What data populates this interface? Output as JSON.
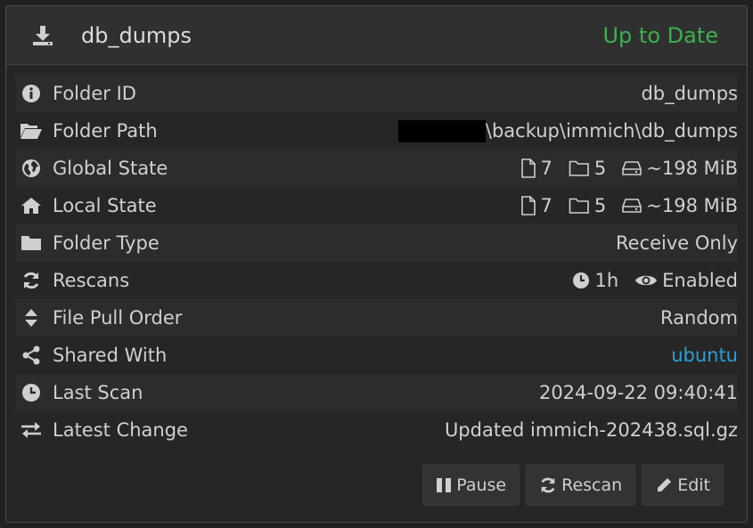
{
  "header": {
    "title": "db_dumps",
    "status": "Up to Date",
    "status_color": "#3bb14c",
    "icon": "download-icon"
  },
  "rows": [
    {
      "label": "Folder ID",
      "icon": "info-circle-icon",
      "value": "db_dumps"
    },
    {
      "label": "Folder Path",
      "icon": "folder-open-icon",
      "value": "\\backup\\immich\\db_dumps",
      "redacted": true
    },
    {
      "label": "Global State",
      "icon": "globe-icon",
      "files": "7",
      "folders": "5",
      "size": "~198 MiB"
    },
    {
      "label": "Local State",
      "icon": "home-icon",
      "files": "7",
      "folders": "5",
      "size": "~198 MiB"
    },
    {
      "label": "Folder Type",
      "icon": "folder-icon",
      "value": "Receive Only"
    },
    {
      "label": "Rescans",
      "icon": "refresh-icon",
      "interval": "1h",
      "watch": "Enabled"
    },
    {
      "label": "File Pull Order",
      "icon": "sort-icon",
      "value": "Random"
    },
    {
      "label": "Shared With",
      "icon": "share-icon",
      "value": "ubuntu",
      "link_color": "#2a9fd6"
    },
    {
      "label": "Last Scan",
      "icon": "clock-icon",
      "value": "2024-09-22 09:40:41"
    },
    {
      "label": "Latest Change",
      "icon": "exchange-icon",
      "value": "Updated immich-202438.sql.gz"
    }
  ],
  "buttons": {
    "pause": "Pause",
    "rescan": "Rescan",
    "edit": "Edit"
  }
}
